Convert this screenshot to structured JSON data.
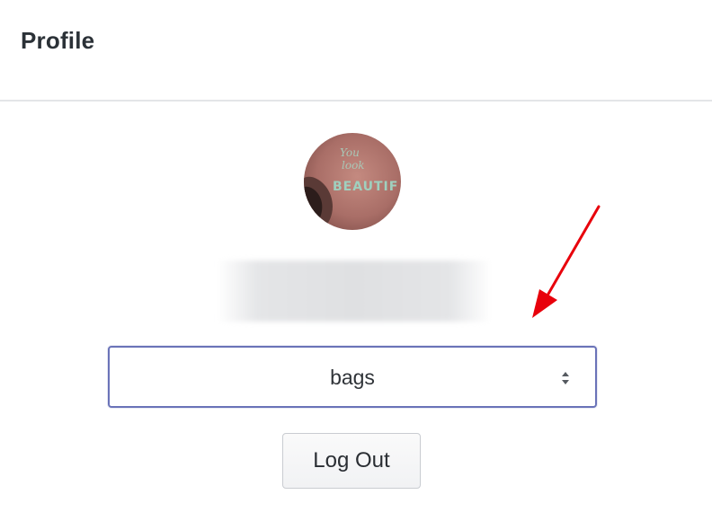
{
  "header": {
    "title": "Profile"
  },
  "profile": {
    "avatar_icon": "user-avatar-photo",
    "username": ""
  },
  "category_select": {
    "value": "bags",
    "icon": "up-down-chevron-icon"
  },
  "actions": {
    "logout_label": "Log Out"
  },
  "colors": {
    "select_border": "#6a73b8",
    "annotation_arrow": "#e8000b",
    "divider": "#e3e5e8"
  }
}
